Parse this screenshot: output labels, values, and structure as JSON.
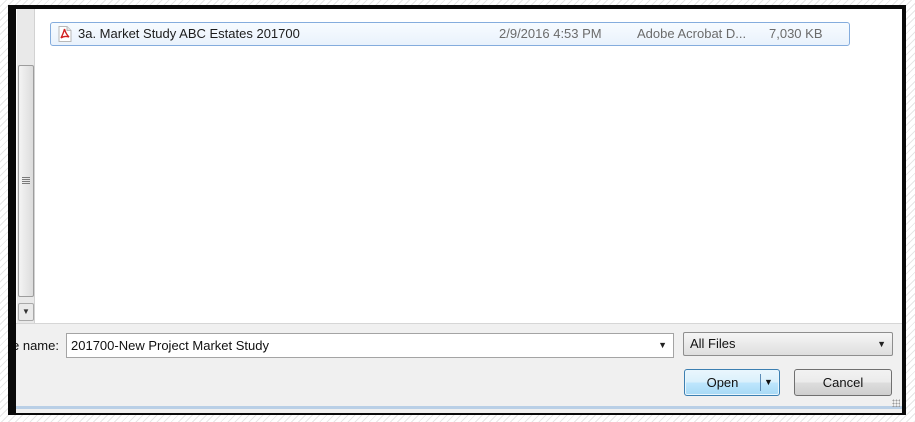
{
  "file_list": {
    "rows": [
      {
        "icon": "pdf-icon",
        "name": "3a. Market Study ABC Estates 201700",
        "date_modified": "2/9/2016 4:53 PM",
        "type": "Adobe Acrobat D...",
        "size": "7,030 KB",
        "selected": true
      }
    ]
  },
  "file_name": {
    "label": "e name:",
    "value": "201700-New Project Market Study",
    "dropdown_icon": "chevron-down-icon"
  },
  "file_type_filter": {
    "selected": "All Files",
    "dropdown_icon": "chevron-down-icon"
  },
  "buttons": {
    "open_label": "Open",
    "open_dropdown_icon": "chevron-down-icon",
    "cancel_label": "Cancel"
  },
  "colors": {
    "selection_border": "#84acdd",
    "primary_button_border": "#3c7fb1",
    "frame": "#0a0a0a"
  }
}
